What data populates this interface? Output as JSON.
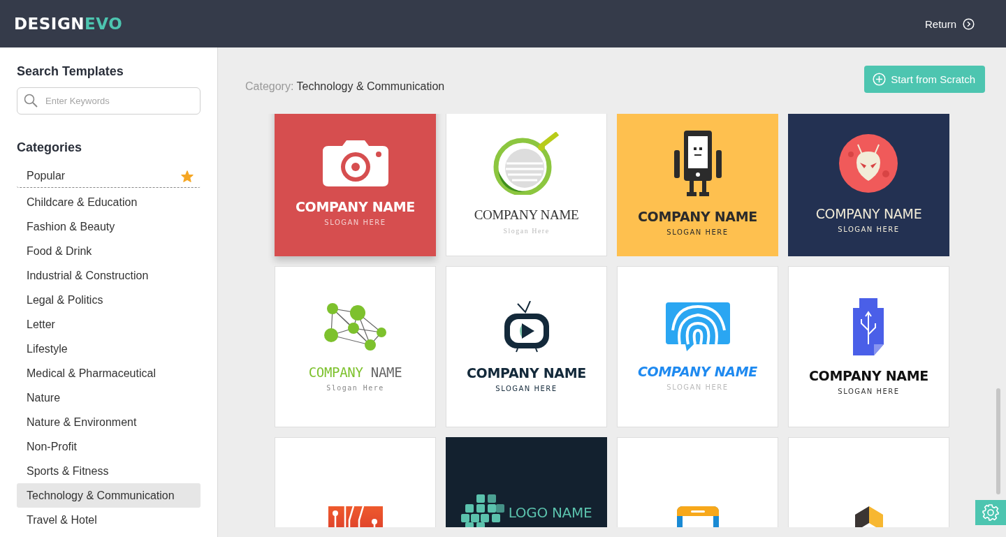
{
  "header": {
    "logo_main": "DESIGN",
    "logo_accent": "EVO",
    "return_label": "Return"
  },
  "sidebar": {
    "search_title": "Search Templates",
    "search": {
      "placeholder": "Enter Keywords"
    },
    "categories_title": "Categories",
    "categories": [
      {
        "label": "Popular",
        "selected": false,
        "starred": true
      },
      {
        "label": "Childcare & Education",
        "selected": false,
        "starred": false
      },
      {
        "label": "Fashion & Beauty",
        "selected": false,
        "starred": false
      },
      {
        "label": "Food & Drink",
        "selected": false,
        "starred": false
      },
      {
        "label": "Industrial & Construction",
        "selected": false,
        "starred": false
      },
      {
        "label": "Legal & Politics",
        "selected": false,
        "starred": false
      },
      {
        "label": "Letter",
        "selected": false,
        "starred": false
      },
      {
        "label": "Lifestyle",
        "selected": false,
        "starred": false
      },
      {
        "label": "Medical & Pharmaceutical",
        "selected": false,
        "starred": false
      },
      {
        "label": "Nature",
        "selected": false,
        "starred": false
      },
      {
        "label": "Nature & Environment",
        "selected": false,
        "starred": false
      },
      {
        "label": "Non-Profit",
        "selected": false,
        "starred": false
      },
      {
        "label": "Sports & Fitness",
        "selected": false,
        "starred": false
      },
      {
        "label": "Technology & Communication",
        "selected": true,
        "starred": false
      },
      {
        "label": "Travel & Hotel",
        "selected": false,
        "starred": false
      }
    ]
  },
  "main": {
    "category_label": "Category:",
    "category_value": "Technology & Communication",
    "start_button": "Start from Scratch",
    "templates": [
      {
        "kind": "camera",
        "name": "COMPANY NAME",
        "slogan": "SLOGAN HERE"
      },
      {
        "kind": "satellite",
        "name": "COMPANY NAME",
        "slogan": "Slogan Here"
      },
      {
        "kind": "robot",
        "name": "COMPANY NAME",
        "slogan": "SLOGAN HERE"
      },
      {
        "kind": "alien",
        "name": "COMPANY NAME",
        "slogan": "SLOGAN HERE"
      },
      {
        "kind": "network",
        "name_parts": [
          "COMPANY",
          "NAME"
        ],
        "slogan": "Slogan Here"
      },
      {
        "kind": "tv",
        "name": "COMPANY NAME",
        "slogan": "SLOGAN HERE"
      },
      {
        "kind": "fingerprint",
        "name": "COMPANY NAME",
        "slogan": "SLOGAN HERE"
      },
      {
        "kind": "usb",
        "name": "COMPANY NAME",
        "slogan": "SLOGAN HERE"
      },
      {
        "kind": "circuit"
      },
      {
        "kind": "pixels",
        "name": "LOGO NAME"
      },
      {
        "kind": "phone"
      },
      {
        "kind": "cubes"
      }
    ]
  }
}
